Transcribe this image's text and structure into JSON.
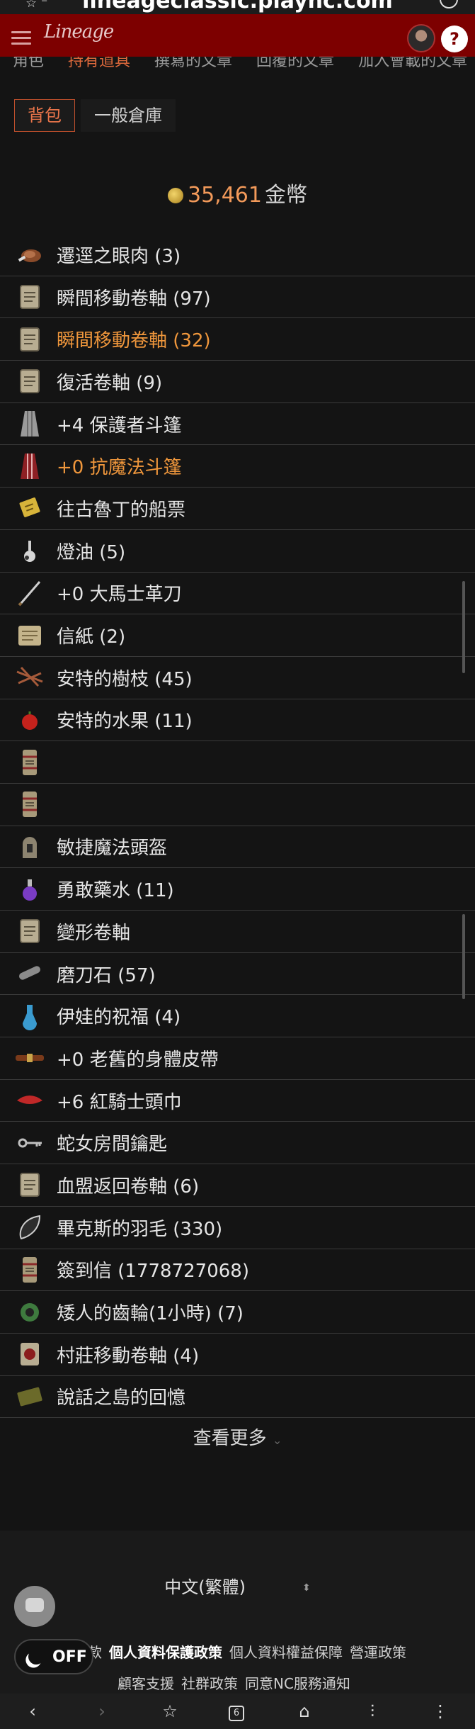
{
  "browser": {
    "url": "lineageclassic.plaync.com"
  },
  "header": {
    "logo_text": "Lineage",
    "help_label": "?"
  },
  "subnav": {
    "items": [
      {
        "label": "角色",
        "active": false
      },
      {
        "label": "持有道具",
        "active": true
      },
      {
        "label": "撰寫的文章",
        "active": false
      },
      {
        "label": "回覆的文章",
        "active": false
      },
      {
        "label": "加入會載的文章",
        "active": false
      }
    ]
  },
  "warehouse_tabs": [
    {
      "label": "背包",
      "active": true
    },
    {
      "label": "一般倉庫",
      "active": false
    }
  ],
  "money": {
    "amount": "35,461",
    "unit": "金幣"
  },
  "items": [
    {
      "name": "遷逕之眼肉 (3)",
      "icon": "meat-icon",
      "highlight": false
    },
    {
      "name": "瞬間移動卷軸 (97)",
      "icon": "scroll-icon",
      "highlight": false
    },
    {
      "name": "瞬間移動卷軸 (32)",
      "icon": "scroll-icon",
      "highlight": true
    },
    {
      "name": "復活卷軸 (9)",
      "icon": "scroll-icon",
      "highlight": false
    },
    {
      "name": "+4 保護者斗篷",
      "icon": "cloak-grey-icon",
      "highlight": false
    },
    {
      "name": "+0 抗魔法斗篷",
      "icon": "cloak-red-icon",
      "highlight": true
    },
    {
      "name": "往古魯丁的船票",
      "icon": "ticket-icon",
      "highlight": false
    },
    {
      "name": "燈油 (5)",
      "icon": "oil-icon",
      "highlight": false
    },
    {
      "name": "+0 大馬士革刀",
      "icon": "sword-icon",
      "highlight": false
    },
    {
      "name": "信紙 (2)",
      "icon": "paper-icon",
      "highlight": false
    },
    {
      "name": "安特的樹枝 (45)",
      "icon": "branch-icon",
      "highlight": false
    },
    {
      "name": "安特的水果 (11)",
      "icon": "apple-icon",
      "highlight": false
    },
    {
      "name": "",
      "icon": "bundle-icon",
      "highlight": false
    },
    {
      "name": "",
      "icon": "bundle-icon",
      "highlight": false
    },
    {
      "name": "敏捷魔法頭盔",
      "icon": "helmet-icon",
      "highlight": false
    },
    {
      "name": "勇敢藥水 (11)",
      "icon": "potion-purple-icon",
      "highlight": false
    },
    {
      "name": "變形卷軸",
      "icon": "scroll-icon",
      "highlight": false
    },
    {
      "name": "磨刀石 (57)",
      "icon": "whetstone-icon",
      "highlight": false
    },
    {
      "name": "伊娃的祝福 (4)",
      "icon": "potion-blue-icon",
      "highlight": false
    },
    {
      "name": "+0 老舊的身體皮帶",
      "icon": "belt-icon",
      "highlight": false
    },
    {
      "name": "+6 紅騎士頭巾",
      "icon": "bandana-icon",
      "highlight": false
    },
    {
      "name": "蛇女房間鑰匙",
      "icon": "key-icon",
      "highlight": false
    },
    {
      "name": "血盟返回卷軸 (6)",
      "icon": "scroll-icon",
      "highlight": false
    },
    {
      "name": "畢克斯的羽毛 (330)",
      "icon": "feather-icon",
      "highlight": false
    },
    {
      "name": "簽到信 (1778727068)",
      "icon": "bundle-icon",
      "highlight": false
    },
    {
      "name": "矮人的齒輪(1小時) (7)",
      "icon": "gear-item-icon",
      "highlight": false
    },
    {
      "name": "村莊移動卷軸 (4)",
      "icon": "scroll-red-icon",
      "highlight": false
    },
    {
      "name": "說話之島的回憶",
      "icon": "book-icon",
      "highlight": false
    }
  ],
  "see_more_label": "查看更多",
  "footer": {
    "language": "中文(繁體)",
    "links_row1": [
      {
        "label": "款",
        "bold": false
      },
      {
        "label": "個人資料保護政策",
        "bold": true
      },
      {
        "label": "個人資料權益保障",
        "bold": false
      },
      {
        "label": "營運政策",
        "bold": false
      }
    ],
    "links_row2": [
      "顧客支援",
      "社群政策",
      "同意NC服務通知"
    ]
  },
  "dark_toggle": {
    "label": "OFF"
  },
  "android_nav": {
    "tab_count": "6"
  },
  "colors": {
    "header_bg": "#7d0000",
    "highlight_text": "#f0973c",
    "money_text": "#f39a5a",
    "active_tab_border": "#c0502c",
    "page_bg": "#141414"
  }
}
